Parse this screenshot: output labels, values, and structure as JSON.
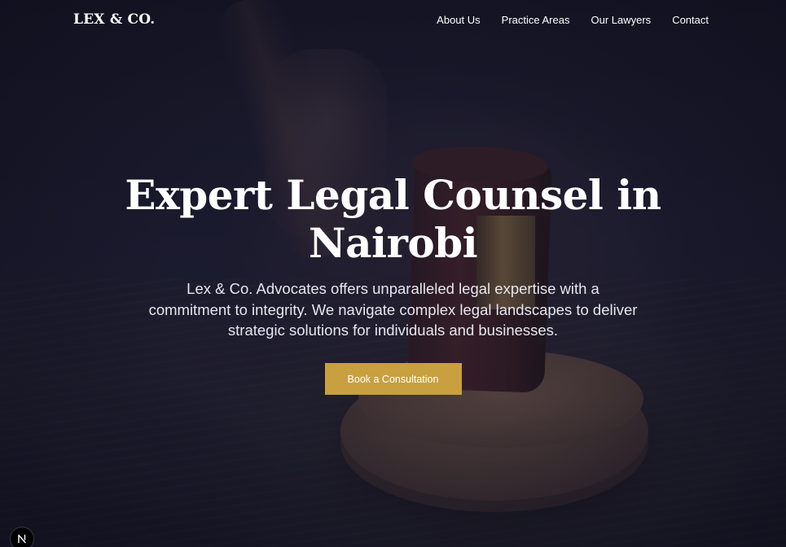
{
  "brand": {
    "logo_text": "LEX & CO."
  },
  "nav": {
    "items": [
      {
        "label": "About Us"
      },
      {
        "label": "Practice Areas"
      },
      {
        "label": "Our Lawyers"
      },
      {
        "label": "Contact"
      }
    ]
  },
  "hero": {
    "title": "Expert Legal Counsel in Nairobi",
    "subtitle": "Lex & Co. Advocates offers unparalleled legal expertise with a commitment to integrity. We navigate complex legal landscapes to deliver strategic solutions for individuals and businesses.",
    "cta_label": "Book a Consultation",
    "background_image": "gavel-on-sound-block-photo"
  },
  "dev_badge": {
    "icon": "nextjs-logo-icon"
  },
  "colors": {
    "accent": "#c9a03f",
    "overlay": "#14142a",
    "text": "#ffffff"
  }
}
